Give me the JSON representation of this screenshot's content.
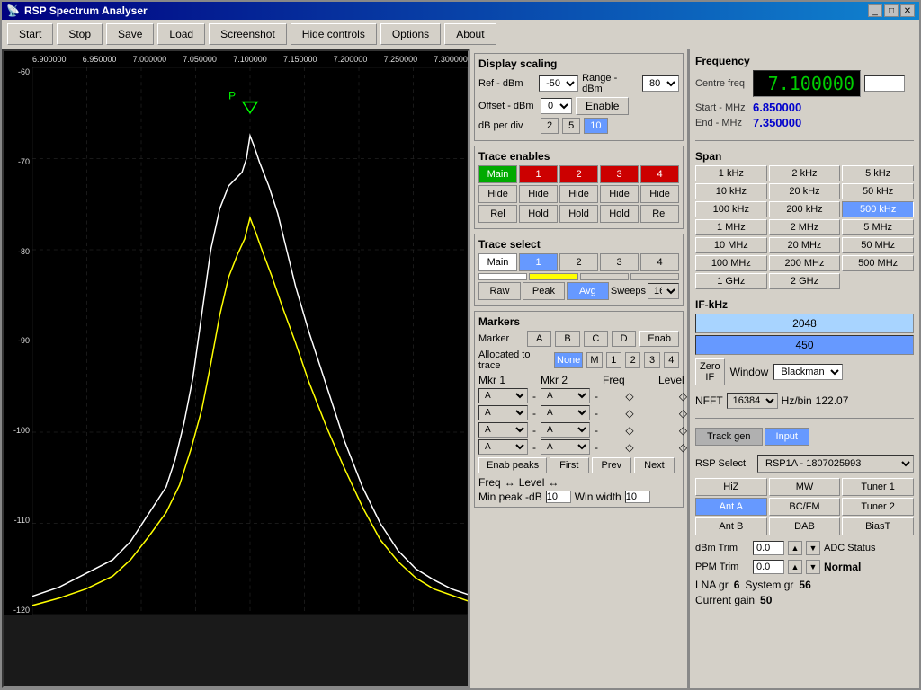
{
  "window": {
    "title": "RSP Spectrum Analyser"
  },
  "toolbar": {
    "start_label": "Start",
    "stop_label": "Stop",
    "save_label": "Save",
    "load_label": "Load",
    "screenshot_label": "Screenshot",
    "hide_controls_label": "Hide controls",
    "options_label": "Options",
    "about_label": "About"
  },
  "spectrum": {
    "freq_labels": [
      "6.900000",
      "6.950000",
      "7.000000",
      "7.050000",
      "7.100000",
      "7.150000",
      "7.200000",
      "7.250000",
      "7.300000"
    ],
    "y_labels": [
      "-60",
      "-70",
      "-80",
      "-90",
      "-100",
      "-110",
      "-120"
    ]
  },
  "display_scaling": {
    "title": "Display scaling",
    "ref_dbm_label": "Ref - dBm",
    "ref_value": "-50",
    "range_dbm_label": "Range - dBm",
    "range_value": "80",
    "offset_dbm_label": "Offset - dBm",
    "offset_value": "0",
    "enable_label": "Enable",
    "db_per_div_label": "dB per div",
    "db_options": [
      "2",
      "5",
      "10"
    ],
    "db_active": "10"
  },
  "trace_enables": {
    "title": "Trace enables",
    "main_label": "Main",
    "traces": [
      "1",
      "2",
      "3",
      "4"
    ],
    "hide_labels": [
      "Hide",
      "Hide",
      "Hide",
      "Hide",
      "Hide"
    ],
    "rel_labels": [
      "Rel",
      "Hold",
      "Hold",
      "Hold",
      "Rel"
    ]
  },
  "trace_select": {
    "title": "Trace select",
    "main_label": "Main",
    "traces": [
      "1",
      "2",
      "3",
      "4"
    ],
    "raw_label": "Raw",
    "peak_label": "Peak",
    "avg_label": "Avg",
    "sweeps_label": "Sweeps",
    "sweeps_value": "16"
  },
  "markers": {
    "title": "Markers",
    "marker_label": "Marker",
    "letters": [
      "A",
      "B",
      "C",
      "D"
    ],
    "enab_label": "Enab",
    "alloc_label": "Allocated to trace",
    "alloc_options": [
      "None",
      "M",
      "1",
      "2",
      "3",
      "4"
    ],
    "alloc_active": "None",
    "mkr1_label": "Mkr 1",
    "mkr2_label": "Mkr 2",
    "freq_label": "Freq",
    "level_label": "Level",
    "enab_peaks_label": "Enab peaks",
    "first_label": "First",
    "prev_label": "Prev",
    "next_label": "Next",
    "freq_arrow": "◇",
    "level_arrow": "◇",
    "freq_win_label": "Freq",
    "freq_icon": "↔",
    "level_icon": "↔",
    "min_peak_label": "Min peak -dB",
    "min_peak_value": "10",
    "win_width_label": "Win width",
    "win_width_value": "10"
  },
  "frequency": {
    "title": "Frequency",
    "centre_freq_label": "Centre freq",
    "centre_freq_value": "7.100000",
    "start_mhz_label": "Start - MHz",
    "start_mhz_value": "6.850000",
    "end_mhz_label": "End - MHz",
    "end_mhz_value": "7.350000"
  },
  "span": {
    "title": "Span",
    "buttons": [
      {
        "label": "1 kHz"
      },
      {
        "label": "2 kHz"
      },
      {
        "label": "5 kHz"
      },
      {
        "label": "10 kHz"
      },
      {
        "label": "20 kHz"
      },
      {
        "label": "50 kHz"
      },
      {
        "label": "100 kHz"
      },
      {
        "label": "200 kHz"
      },
      {
        "label": "500 kHz"
      },
      {
        "label": "1 MHz"
      },
      {
        "label": "2 MHz"
      },
      {
        "label": "5 MHz"
      },
      {
        "label": "10 MHz"
      },
      {
        "label": "20 MHz"
      },
      {
        "label": "50 MHz"
      },
      {
        "label": "100 MHz"
      },
      {
        "label": "200 MHz"
      },
      {
        "label": "500 MHz"
      },
      {
        "label": "1 GHz"
      },
      {
        "label": "2 GHz"
      }
    ],
    "active": "500 kHz"
  },
  "if_khz": {
    "title": "IF-kHz",
    "options": [
      "2048",
      "450"
    ],
    "active": "450",
    "zero_if_label": "Zero IF",
    "window_label": "Window",
    "window_value": "Blackman"
  },
  "nfft": {
    "label": "NFFT",
    "value": "16384",
    "hz_bin_label": "Hz/bin",
    "hz_bin_value": "122.07"
  },
  "tabs": {
    "track_gen_label": "Track gen",
    "input_label": "Input",
    "active": "Input"
  },
  "input": {
    "title": "Input",
    "rsp_select_label": "RSP Select",
    "rsp_value": "RSP1A - 1807025993",
    "hiz_label": "HiZ",
    "mw_label": "MW",
    "tuner1_label": "Tuner 1",
    "ant_a_label": "Ant A",
    "bcfm_label": "BC/FM",
    "tuner2_label": "Tuner 2",
    "ant_b_label": "Ant B",
    "dab_label": "DAB",
    "biast_label": "BiasT",
    "dbm_trim_label": "dBm Trim",
    "dbm_trim_value": "0.0",
    "adc_status_label": "ADC Status",
    "ppm_trim_label": "PPM Trim",
    "ppm_trim_value": "0.0",
    "normal_label": "Normal",
    "lna_gr_label": "LNA gr",
    "lna_gr_value": "6",
    "system_gr_label": "System gr",
    "system_gr_value": "56",
    "current_gain_label": "Current gain",
    "current_gain_value": "50"
  }
}
